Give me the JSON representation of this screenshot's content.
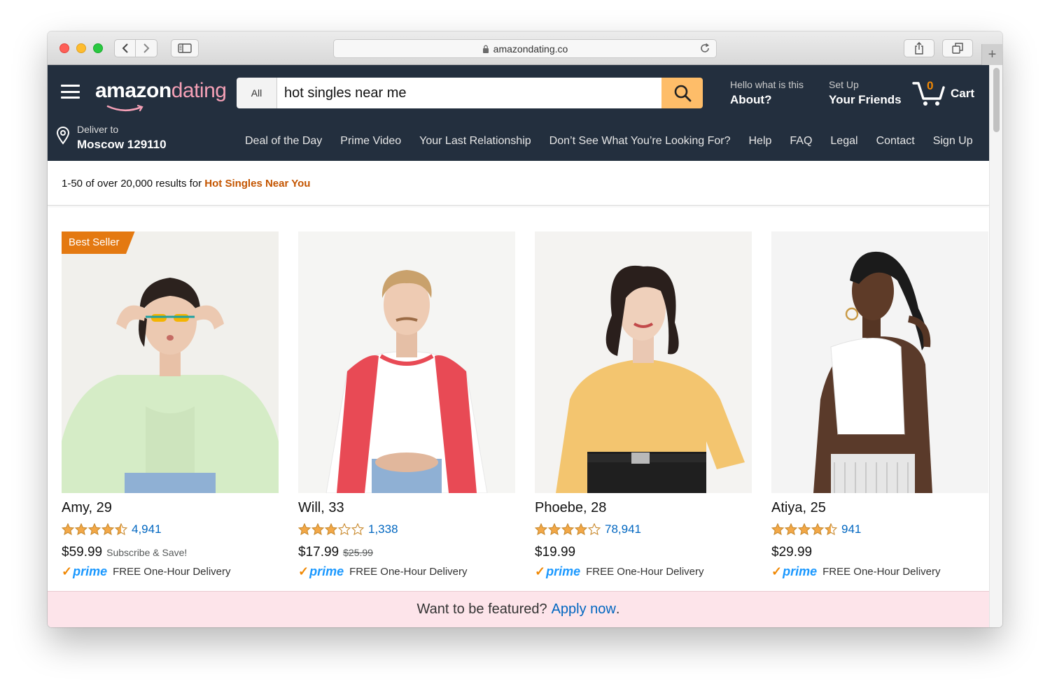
{
  "browser": {
    "url": "amazondating.co",
    "new_tab_symbol": "+"
  },
  "header": {
    "logo_primary": "amazon",
    "logo_secondary": "dating",
    "search": {
      "category": "All",
      "query": "hot singles near me"
    },
    "about": {
      "line1": "Hello what is this",
      "line2": "About?"
    },
    "friends": {
      "line1": "Set Up",
      "line2": "Your Friends"
    },
    "cart": {
      "count": "0",
      "label": "Cart"
    },
    "deliver": {
      "line1": "Deliver to",
      "line2": "Moscow 129110"
    },
    "nav": [
      "Deal of the Day",
      "Prime Video",
      "Your Last Relationship",
      "Don’t See What You’re Looking For?",
      "Help",
      "FAQ",
      "Legal",
      "Contact",
      "Sign Up"
    ]
  },
  "results": {
    "prefix": "1-50 of over 20,000 results for ",
    "query": "Hot Singles Near You"
  },
  "products": [
    {
      "badge": "Best Seller",
      "name": "Amy, 29",
      "stars": 4.5,
      "reviews": "4,941",
      "price": "$59.99",
      "was_price": "",
      "price_note": "Subscribe & Save!",
      "prime": "prime",
      "shipping": "FREE One-Hour Delivery",
      "shirt_color": "#d5ecc6",
      "bg_color": "#f1f0ec"
    },
    {
      "badge": "",
      "name": "Will, 33",
      "stars": 3,
      "reviews": "1,338",
      "price": "$17.99",
      "was_price": "$25.99",
      "price_note": "",
      "prime": "prime",
      "shipping": "FREE One-Hour Delivery",
      "shirt_color": "#ffffff",
      "bg_color": "#f5f5f3"
    },
    {
      "badge": "",
      "name": "Phoebe, 28",
      "stars": 4,
      "reviews": "78,941",
      "price": "$19.99",
      "was_price": "",
      "price_note": "",
      "prime": "prime",
      "shipping": "FREE One-Hour Delivery",
      "shirt_color": "#f3c56f",
      "bg_color": "#f4f3f1"
    },
    {
      "badge": "",
      "name": "Atiya, 25",
      "stars": 4.5,
      "reviews": "941",
      "price": "$29.99",
      "was_price": "",
      "price_note": "",
      "prime": "prime",
      "shipping": "FREE One-Hour Delivery",
      "shirt_color": "#ffffff",
      "bg_color": "#f4f4f4"
    }
  ],
  "banner": {
    "text": "Want to be featured?",
    "link": "Apply now",
    "period": "."
  },
  "colors": {
    "header_bg": "#232f3e",
    "search_button": "#febd69",
    "accent_orange": "#e47911",
    "link_blue": "#0066c0",
    "star_gold": "#f3a847",
    "banner_bg": "#fde4ea"
  }
}
